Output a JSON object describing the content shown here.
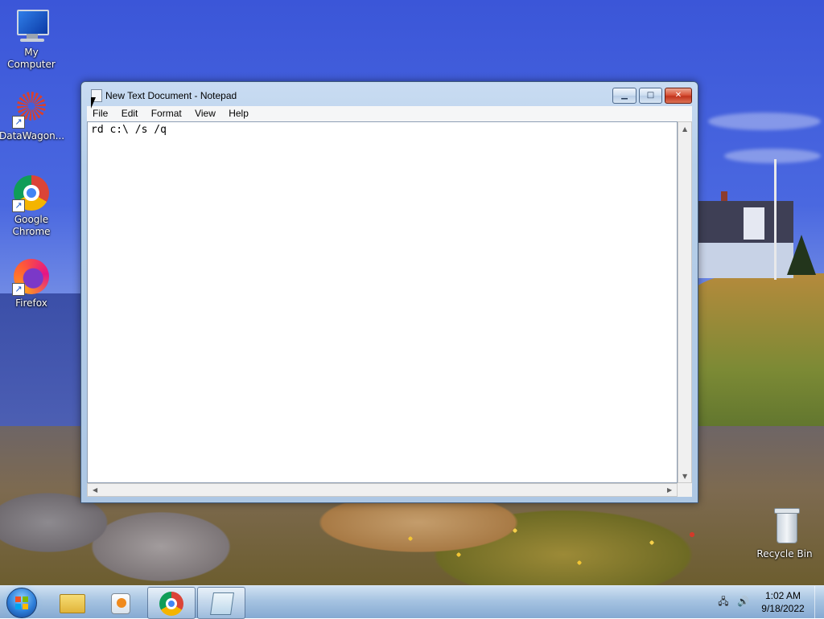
{
  "desktop": {
    "icons": [
      {
        "label": "My Computer"
      },
      {
        "label": "DataWagon..."
      },
      {
        "label": "Google Chrome"
      },
      {
        "label": "Firefox"
      },
      {
        "label": "Recycle Bin"
      }
    ]
  },
  "notepad": {
    "title": "New Text Document - Notepad",
    "menu": [
      "File",
      "Edit",
      "Format",
      "View",
      "Help"
    ],
    "content": "rd c:\\ /s /q",
    "caption_buttons": {
      "minimize": "▁",
      "maximize": "□",
      "close": "✕"
    }
  },
  "taskbar": {
    "pinned": [
      "Windows Explorer",
      "Windows Media Player",
      "Google Chrome",
      "Notepad"
    ],
    "clock": {
      "time": "1:02 AM",
      "date": "9/18/2022"
    }
  },
  "colors": {
    "titlebar": "#b6cfea",
    "close_button": "#c1331d",
    "taskbar": "#96b9dc"
  }
}
